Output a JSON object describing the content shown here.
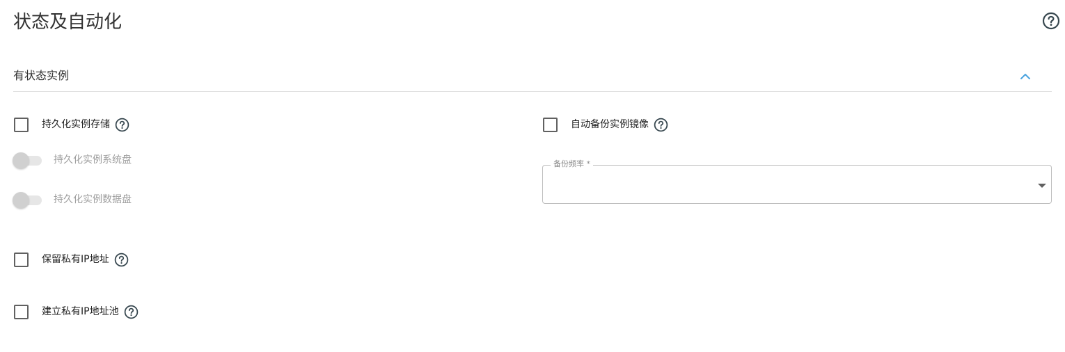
{
  "page": {
    "title": "状态及自动化",
    "help_icon": "question-circle-icon"
  },
  "section": {
    "title": "有状态实例",
    "collapse_icon": "chevron-up-icon",
    "accent_color": "#4aa3df"
  },
  "options": {
    "persist_storage": {
      "label": "持久化实例存储",
      "checked": false
    },
    "persist_system_disk": {
      "label": "持久化实例系统盘",
      "enabled": false,
      "on": false
    },
    "persist_data_disk": {
      "label": "持久化实例数据盘",
      "enabled": false,
      "on": false
    },
    "auto_backup": {
      "label": "自动备份实例镜像",
      "checked": false
    },
    "backup_frequency": {
      "label": "备份频率 *",
      "value": ""
    },
    "reserve_private_ip": {
      "label": "保留私有IP地址",
      "checked": false
    },
    "private_ip_pool": {
      "label": "建立私有IP地址池",
      "checked": false
    }
  }
}
